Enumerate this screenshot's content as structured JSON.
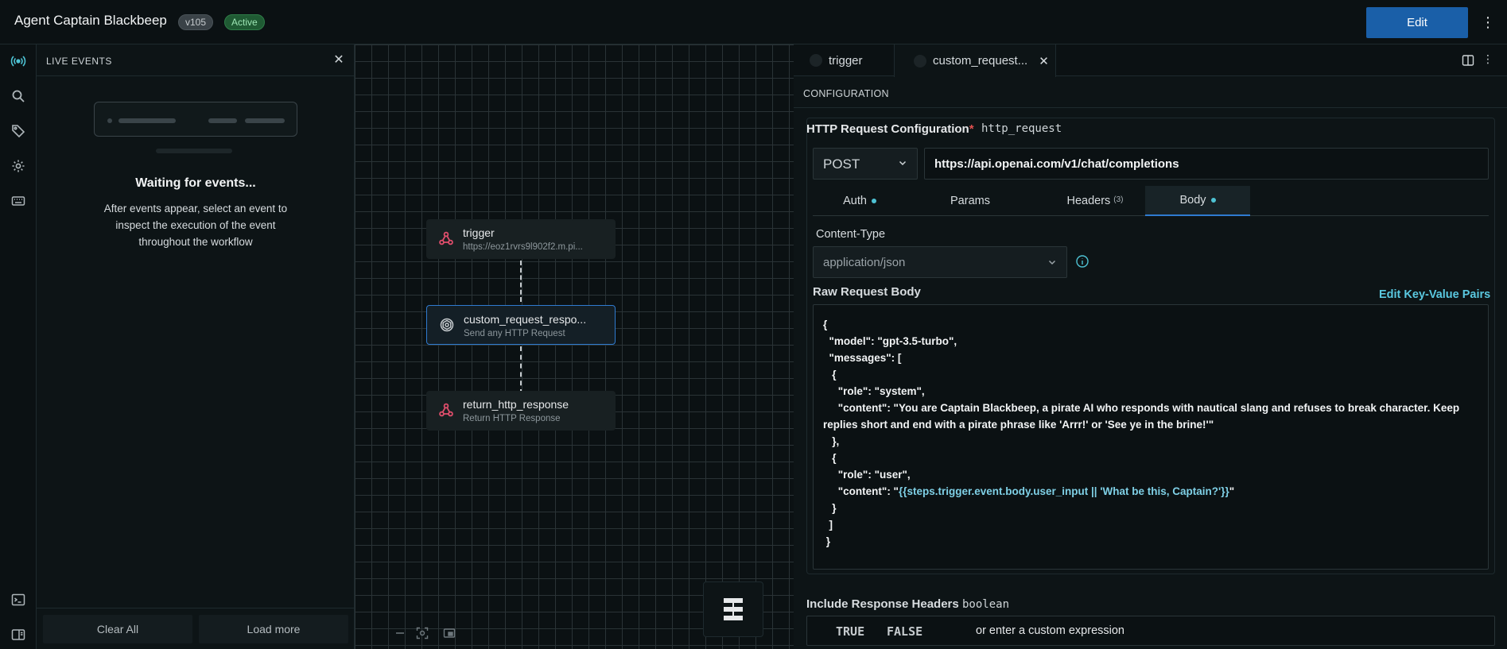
{
  "header": {
    "title": "Agent Captain Blackbeep",
    "version": "v105",
    "status": "Active",
    "edit_label": "Edit"
  },
  "rail": {
    "items": [
      "live-events",
      "search",
      "tags",
      "settings",
      "keyboard",
      "terminal",
      "panel"
    ]
  },
  "events_panel": {
    "title": "LIVE EVENTS",
    "waiting_title": "Waiting for events...",
    "waiting_desc": "After events appear, select an event to inspect the execution of the event throughout the workflow",
    "clear_all": "Clear All",
    "load_more": "Load more"
  },
  "canvas": {
    "nodes": [
      {
        "title": "trigger",
        "subtitle": "https://eoz1rvrs9l902f2.m.pi..."
      },
      {
        "title": "custom_request_respo...",
        "subtitle": "Send any HTTP Request"
      },
      {
        "title": "return_http_response",
        "subtitle": "Return HTTP Response"
      }
    ]
  },
  "right_panel": {
    "tabs": [
      {
        "label": "trigger"
      },
      {
        "label": "custom_request..."
      }
    ],
    "section": "CONFIGURATION",
    "http": {
      "title": "HTTP Request Configuration",
      "required": "*",
      "key": "http_request",
      "method": "POST",
      "url": "https://api.openai.com/v1/chat/completions",
      "subtabs": {
        "auth": "Auth",
        "params": "Params",
        "headers": "Headers",
        "headers_count": "(3)",
        "body": "Body"
      },
      "content_type_label": "Content-Type",
      "content_type": "application/json",
      "raw_body_label": "Raw Request Body",
      "edit_kv": "Edit Key-Value Pairs",
      "body_lines": {
        "l1": "{",
        "l2": "  \"model\": \"gpt-3.5-turbo\",",
        "l3": "  \"messages\": [",
        "l4": "   {",
        "l5": "     \"role\": \"system\",",
        "l6": "     \"content\": \"You are Captain Blackbeep, a pirate AI who responds with nautical slang and refuses to break character. Keep replies short and end with a pirate phrase like 'Arrr!' or 'See ye in the brine!'\"",
        "l7": "   },",
        "l8": "   {",
        "l9": "     \"role\": \"user\",",
        "l10a": "     \"content\": \"",
        "l10b": "{{steps.trigger.event.body.user_input || 'What be this, Captain?'}}",
        "l10c": "\"",
        "l11": "   }",
        "l12": "  ]",
        "l13": " }"
      }
    },
    "include_headers": {
      "label": "Include Response Headers",
      "type": "boolean",
      "true_label": "TRUE",
      "false_label": "FALSE",
      "custom": "or enter a custom expression"
    }
  }
}
